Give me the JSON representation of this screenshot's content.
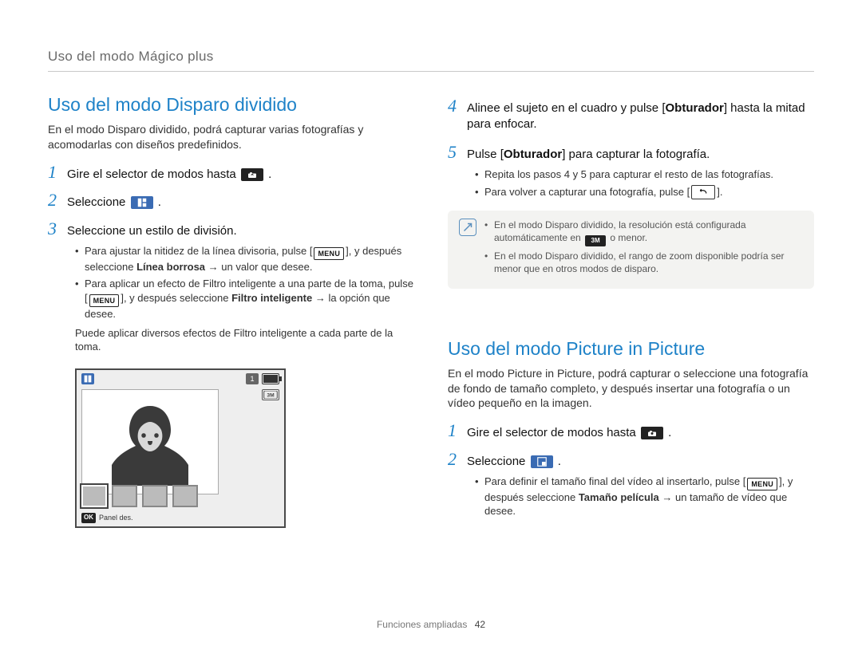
{
  "header": {
    "title": "Uso del modo Mágico plus"
  },
  "left": {
    "heading": "Uso del modo Disparo dividido",
    "intro": "En el modo Disparo dividido, podrá capturar varias fotografías y acomodarlas con diseños predefinidos.",
    "step1": "Gire el selector de modos hasta",
    "step1_after": ".",
    "step2": "Seleccione",
    "step2_after": ".",
    "step3": "Seleccione un estilo de división.",
    "s3_b1_a": "Para ajustar la nitidez de la línea divisoria, pulse [",
    "s3_b1_b": "], y después seleccione",
    "s3_b1_bold": "Línea borrosa",
    "s3_b1_c": " → un valor que desee.",
    "s3_b2_a": "Para aplicar un efecto de Filtro inteligente a una parte de la toma, pulse [",
    "s3_b2_b": "], y después seleccione",
    "s3_b2_bold": "Filtro inteligente",
    "s3_b2_c": " → la opción que desee.",
    "s3_tail": "Puede aplicar diversos efectos de Filtro inteligente a cada parte de la toma.",
    "cam_footer": "Panel des."
  },
  "right": {
    "step4_a": "Alinee el sujeto en el cuadro y pulse [",
    "step4_bold": "Obturador",
    "step4_b": "] hasta la mitad para enfocar.",
    "step5_a": "Pulse [",
    "step5_bold": "Obturador",
    "step5_b": "] para capturar la fotografía.",
    "s5_b1": "Repita los pasos 4 y 5 para capturar el resto de las fotografías.",
    "s5_b2_a": "Para volver a capturar una fotografía, pulse [",
    "s5_b2_b": "].",
    "note1_a": "En el modo Disparo dividido, la resolución está configurada automáticamente en",
    "note1_b": "o menor.",
    "note2": "En el modo Disparo dividido, el rango de zoom disponible podría ser menor que en otros modos de disparo.",
    "heading2": "Uso del modo Picture in Picture",
    "intro2": "En el modo Picture in Picture, podrá capturar o seleccione una fotografía de fondo de tamaño completo, y después insertar una fotografía o un vídeo pequeño en la imagen.",
    "r_step1": "Gire el selector de modos hasta",
    "r_step1_after": ".",
    "r_step2": "Seleccione",
    "r_step2_after": ".",
    "r_s2_b1_a": "Para definir el tamaño final del vídeo al insertarlo, pulse [",
    "r_s2_b1_b": "], y después seleccione",
    "r_s2_b1_bold": "Tamaño película",
    "r_s2_b1_c": " → un tamaño de vídeo que desee."
  },
  "footer": {
    "section": "Funciones ampliadas",
    "page": "42"
  },
  "icons": {
    "mode_dial": "★",
    "menu": "MENU",
    "split": "▥",
    "pip": "▣",
    "res": "3M",
    "back": "↶"
  }
}
